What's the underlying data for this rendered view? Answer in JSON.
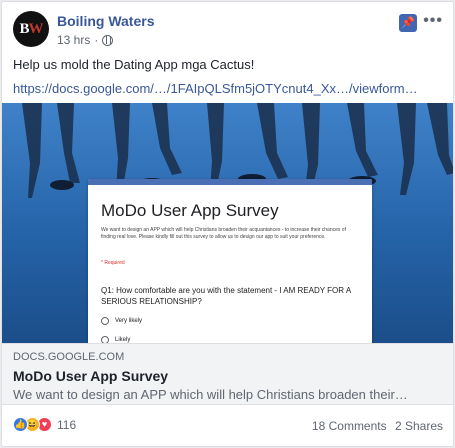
{
  "post": {
    "page_name": "Boiling Waters",
    "avatar_text": "BW",
    "time": "13 hrs",
    "privacy_icon": "globe-icon",
    "text": "Help us mold the Dating App mga Cactus!",
    "link_url": "https://docs.google.com/…/1FAIpQLSfm5jOTYcnut4_Xx…/viewform…"
  },
  "header_actions": {
    "pin_icon": "pin-icon",
    "more_icon": "more-options-icon",
    "more_label": "•••"
  },
  "preview": {
    "form_title": "MoDo User App Survey",
    "form_description": "We want to design an APP which will help Christians broaden their acquantances - to increase their chances of finding real love. Please kindly fill out this survey to allow us to design our app to suit your preference.",
    "required_note": "* Required",
    "question": "Q1: How comfortable are you with the statement - I AM READY FOR A SERIOUS RELATIONSHIP?",
    "options": [
      "Very likely",
      "Likely"
    ]
  },
  "link_card": {
    "domain": "DOCS.GOOGLE.COM",
    "title": "MoDo User App Survey",
    "description": "We want to design an APP which will help Christians broaden their…"
  },
  "engagement": {
    "reaction_icons": [
      "like-icon",
      "haha-icon",
      "love-icon"
    ],
    "reaction_count": "116",
    "comments": "18 Comments",
    "shares": "2 Shares"
  },
  "colors": {
    "link_blue": "#385898",
    "fb_blue": "#4267b2",
    "preview_blue": "#2563a8"
  }
}
